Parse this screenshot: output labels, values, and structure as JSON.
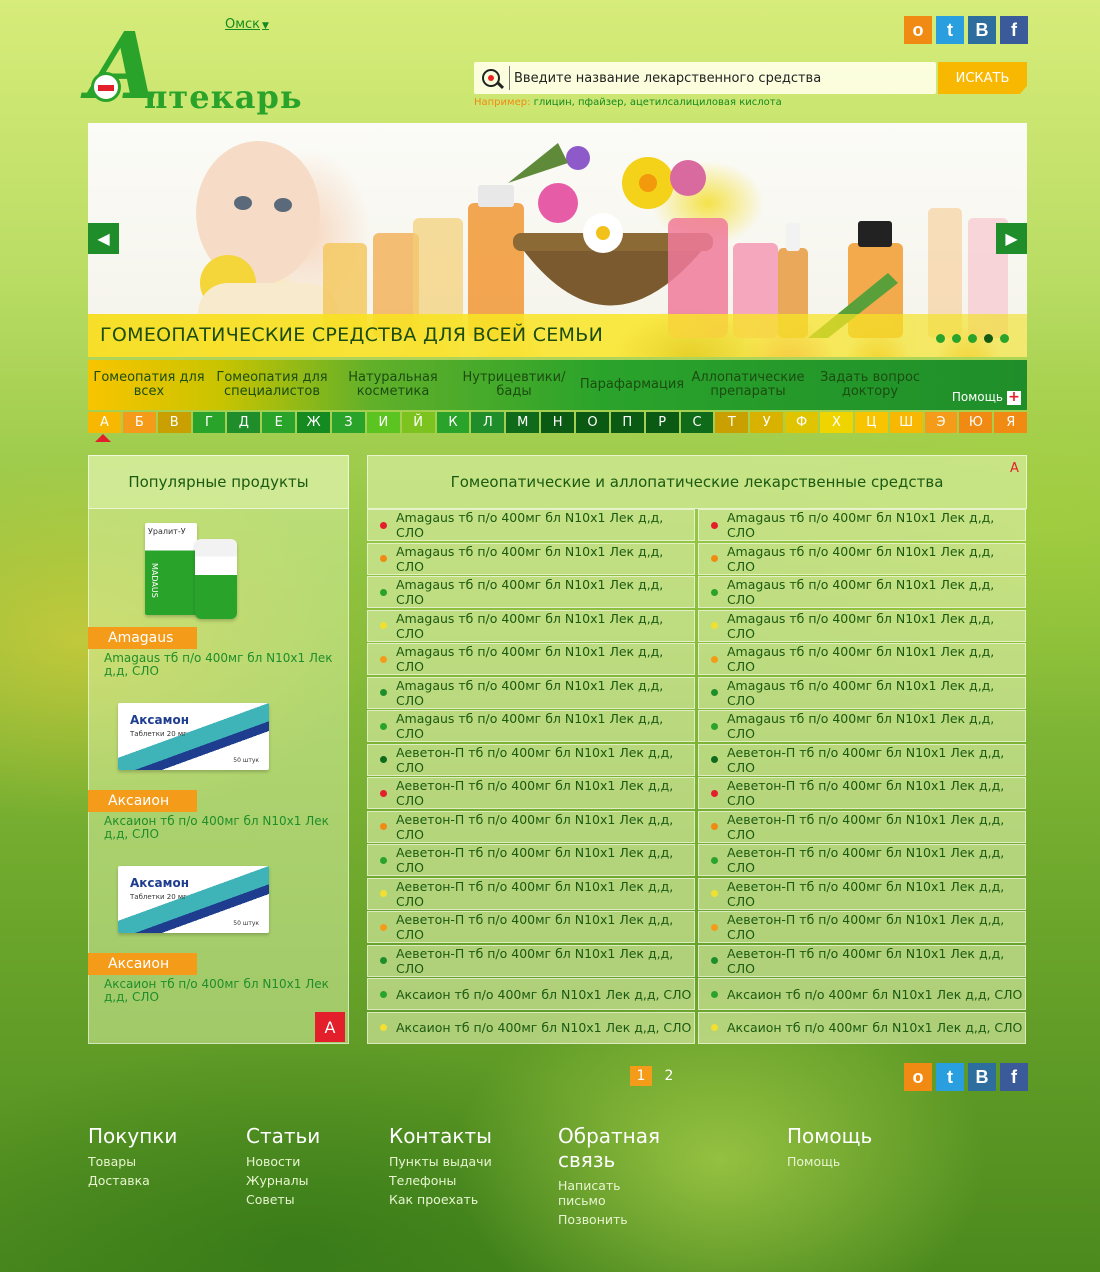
{
  "brand": {
    "name": "Аптекарь"
  },
  "header": {
    "city": "Омск",
    "search_placeholder": "Введите название лекарственного средства",
    "search_button": "ИСКАТЬ",
    "hint_label": "Например:",
    "hint_examples": " глицин, пфайзер, ацетилсалициловая кислота"
  },
  "social": [
    {
      "name": "odnoklassniki-icon",
      "glyph": "о"
    },
    {
      "name": "twitter-icon",
      "glyph": "t"
    },
    {
      "name": "vkontakte-icon",
      "glyph": "В"
    },
    {
      "name": "facebook-icon",
      "glyph": "f"
    }
  ],
  "banner": {
    "title": "ГОМЕОПАТИЧЕСКИЕ СРЕДСТВА ДЛЯ ВСЕЙ СЕМЬИ",
    "prev": "◀",
    "next": "▶",
    "dots": 5,
    "active_dot": 4
  },
  "nav": {
    "items": [
      "Гомеопатия для всех",
      "Гомеопатия для специалистов",
      "Натуральная косметика",
      "Нутрицевтики/ бады",
      "Парафармация",
      "Аллопатические препараты",
      "Задать вопрос доктору"
    ],
    "help": "Помощь",
    "help_plus": "+"
  },
  "alphabet": [
    "А",
    "Б",
    "В",
    "Г",
    "Д",
    "Е",
    "Ж",
    "З",
    "И",
    "Й",
    "К",
    "Л",
    "М",
    "Н",
    "О",
    "П",
    "Р",
    "С",
    "Т",
    "У",
    "Ф",
    "Х",
    "Ц",
    "Ш",
    "Э",
    "Ю",
    "Я"
  ],
  "alphabet_colors": [
    "#f8b700",
    "#f49c1a",
    "#c9a000",
    "#2aa32b",
    "#1f8e2a",
    "#2aa32b",
    "#158a20",
    "#2aa32b",
    "#5bc420",
    "#7cc320",
    "#2aa32b",
    "#1f8e2a",
    "#0f6b1a",
    "#0b5a14",
    "#0b5a14",
    "#0b5a14",
    "#0b5a14",
    "#0f6b1a",
    "#c9a000",
    "#d9b200",
    "#e0c400",
    "#f0d400",
    "#f8c400",
    "#f8b700",
    "#f49c1a",
    "#f08a12",
    "#f08a12"
  ],
  "popular": {
    "title": "Популярные продукты",
    "items": [
      {
        "badge": "Amagaus",
        "desc": "Amagaus тб п/о 400мг бл N10x1 Лек д,д, СЛО",
        "pack_brand": "Уралит-У",
        "pack_maker": "MADAUS"
      },
      {
        "badge": "Аксаион",
        "desc": "Аксаион тб п/о 400мг бл N10x1 Лек д,д, СЛО",
        "pack_brand": "Аксамон",
        "pack_sub": "Таблетки 20 мг",
        "pack_count": "50 штук"
      },
      {
        "badge": "Аксаион",
        "desc": " Аксаион тб п/о 400мг бл N10x1 Лек д,д, СЛО",
        "pack_brand": "Аксамон",
        "pack_sub": "Таблетки 20 мг",
        "pack_count": "50 штук"
      }
    ],
    "corner_letter": "А"
  },
  "drugs": {
    "title": "Гомеопатические и аллопатические лекарственные средства",
    "letter": "А",
    "left": [
      {
        "text": "Amagaus тб п/о 400мг бл N10x1 Лек д,д, СЛО",
        "color": "#e21f2a"
      },
      {
        "text": "Amagaus тб п/о 400мг бл N10x1 Лек д,д, СЛО",
        "color": "#f08a12"
      },
      {
        "text": "Amagaus тб п/о 400мг бл N10x1 Лек д,д, СЛО",
        "color": "#2aa32b"
      },
      {
        "text": "Amagaus тб п/о 400мг бл N10x1 Лек д,д, СЛО",
        "color": "#f2e030"
      },
      {
        "text": "Amagaus тб п/о 400мг бл N10x1 Лек д,д, СЛО",
        "color": "#f49c1a"
      },
      {
        "text": "Amagaus тб п/о 400мг бл N10x1 Лек д,д, СЛО",
        "color": "#1f8e2a"
      },
      {
        "text": "Amagaus тб п/о 400мг бл N10x1 Лек д,д, СЛО",
        "color": "#2aa32b"
      },
      {
        "text": "Аеветон-П тб п/о 400мг бл N10x1 Лек д,д, СЛО",
        "color": "#0f6b1a"
      },
      {
        "text": "Аеветон-П тб п/о 400мг бл N10x1 Лек д,д, СЛО",
        "color": "#e21f2a"
      },
      {
        "text": "Аеветон-П тб п/о 400мг бл N10x1 Лек д,д, СЛО",
        "color": "#f08a12"
      },
      {
        "text": "Аеветон-П тб п/о 400мг бл N10x1 Лек д,д, СЛО",
        "color": "#2aa32b"
      },
      {
        "text": "Аеветон-П тб п/о 400мг бл N10x1 Лек д,д, СЛО",
        "color": "#f2e030"
      },
      {
        "text": "Аеветон-П тб п/о 400мг бл N10x1 Лек д,д, СЛО",
        "color": "#f49c1a"
      },
      {
        "text": "Аеветон-П тб п/о 400мг бл N10x1 Лек д,д, СЛО",
        "color": "#1f8e2a"
      },
      {
        "text": "Аксаион тб п/о 400мг бл N10x1 Лек д,д, СЛО",
        "color": "#2aa32b"
      },
      {
        "text": " Аксаион тб п/о 400мг бл N10x1 Лек д,д, СЛО",
        "color": "#f2e030"
      }
    ],
    "right": [
      {
        "text": "Amagaus тб п/о 400мг бл N10x1 Лек д,д, СЛО",
        "color": "#e21f2a"
      },
      {
        "text": "Amagaus тб п/о 400мг бл N10x1 Лек д,д, СЛО",
        "color": "#f08a12"
      },
      {
        "text": "Amagaus тб п/о 400мг бл N10x1 Лек д,д, СЛО",
        "color": "#2aa32b"
      },
      {
        "text": "Amagaus тб п/о 400мг бл N10x1 Лек д,д, СЛО",
        "color": "#f2e030"
      },
      {
        "text": "Amagaus тб п/о 400мг бл N10x1 Лек д,д, СЛО",
        "color": "#f49c1a"
      },
      {
        "text": "Amagaus тб п/о 400мг бл N10x1 Лек д,д, СЛО",
        "color": "#1f8e2a"
      },
      {
        "text": "Amagaus тб п/о 400мг бл N10x1 Лек д,д, СЛО",
        "color": "#2aa32b"
      },
      {
        "text": "Аеветон-П тб п/о 400мг бл N10x1 Лек д,д, СЛО",
        "color": "#0f6b1a"
      },
      {
        "text": "Аеветон-П тб п/о 400мг бл N10x1 Лек д,д, СЛО",
        "color": "#e21f2a"
      },
      {
        "text": "Аеветон-П тб п/о 400мг бл N10x1 Лек д,д, СЛО",
        "color": "#f08a12"
      },
      {
        "text": "Аеветон-П тб п/о 400мг бл N10x1 Лек д,д, СЛО",
        "color": "#2aa32b"
      },
      {
        "text": "Аеветон-П тб п/о 400мг бл N10x1 Лек д,д, СЛО",
        "color": "#f2e030"
      },
      {
        "text": "Аеветон-П тб п/о 400мг бл N10x1 Лек д,д, СЛО",
        "color": "#f49c1a"
      },
      {
        "text": "Аеветон-П тб п/о 400мг бл N10x1 Лек д,д, СЛО",
        "color": "#1f8e2a"
      },
      {
        "text": " Аксаион тб п/о 400мг бл N10x1 Лек д,д, СЛО",
        "color": "#2aa32b"
      },
      {
        "text": " Аксаион тб п/о 400мг бл N10x1 Лек д,д, СЛО",
        "color": "#f2e030"
      }
    ]
  },
  "pagination": {
    "pages": [
      "1",
      "2"
    ],
    "active": "1"
  },
  "footer": {
    "columns": [
      {
        "title": "Покупки",
        "links": [
          "Товары",
          "Доставка"
        ]
      },
      {
        "title": "Статьи",
        "links": [
          "Новости",
          "Журналы",
          "Советы"
        ]
      },
      {
        "title": "Контакты",
        "links": [
          "Пункты выдачи",
          "Телефоны",
          "Как проехать"
        ]
      },
      {
        "title": "Обратная связь",
        "links": [
          "Написать письмо",
          "Позвонить"
        ]
      },
      {
        "title": "Помощь",
        "links": [
          "Помощь"
        ]
      }
    ]
  }
}
